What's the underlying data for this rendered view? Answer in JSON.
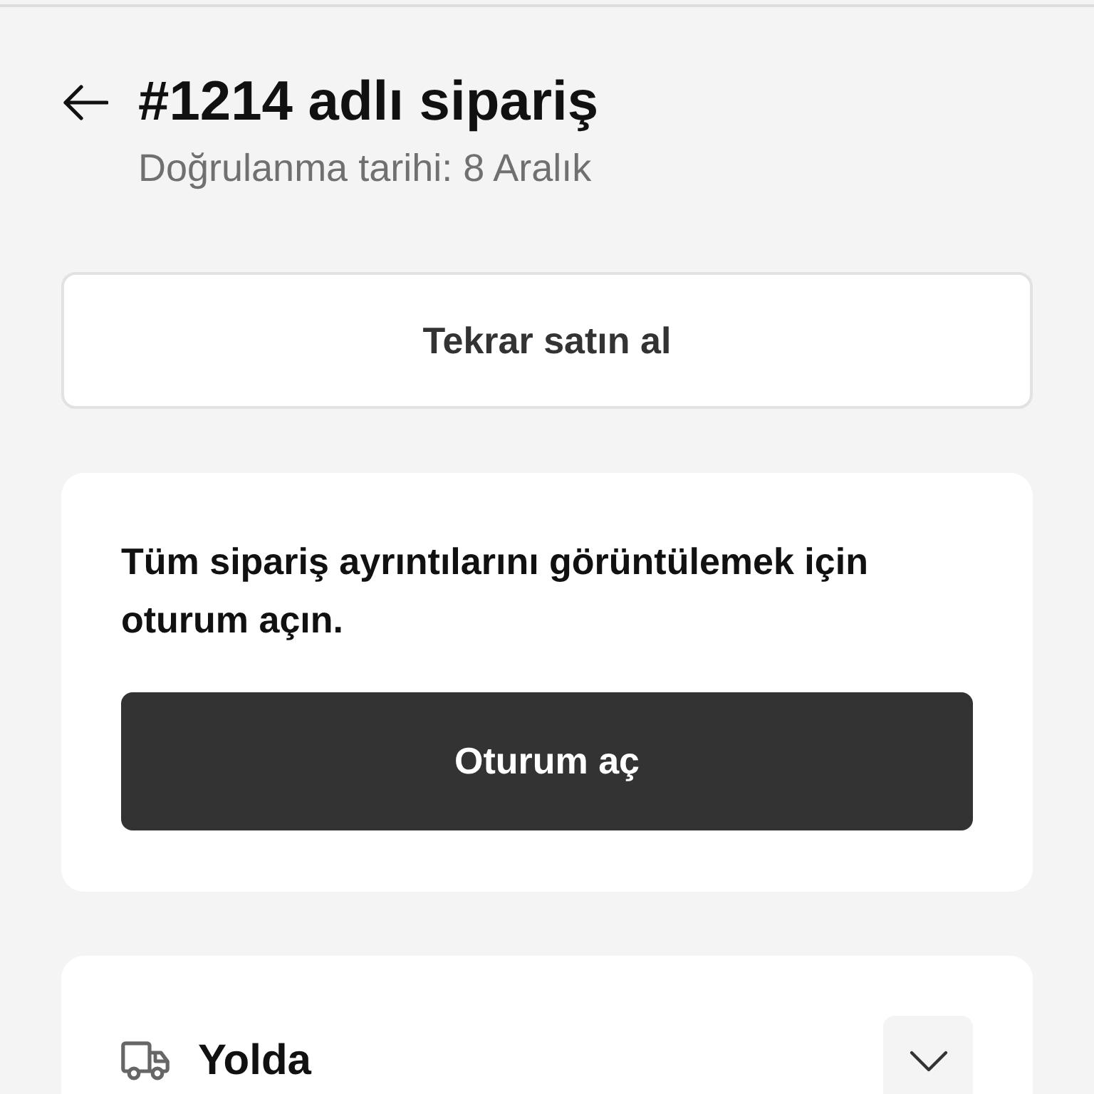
{
  "header": {
    "title": "#1214 adlı sipariş",
    "subtitle": "Doğrulanma tarihi: 8 Aralık"
  },
  "buy_again_button": {
    "label": "Tekrar satın al"
  },
  "sign_in_card": {
    "message": "Tüm sipariş ayrıntılarını görüntülemek için oturum açın.",
    "button": "Oturum aç"
  },
  "status_card": {
    "label": "Yolda",
    "expanded": false
  }
}
